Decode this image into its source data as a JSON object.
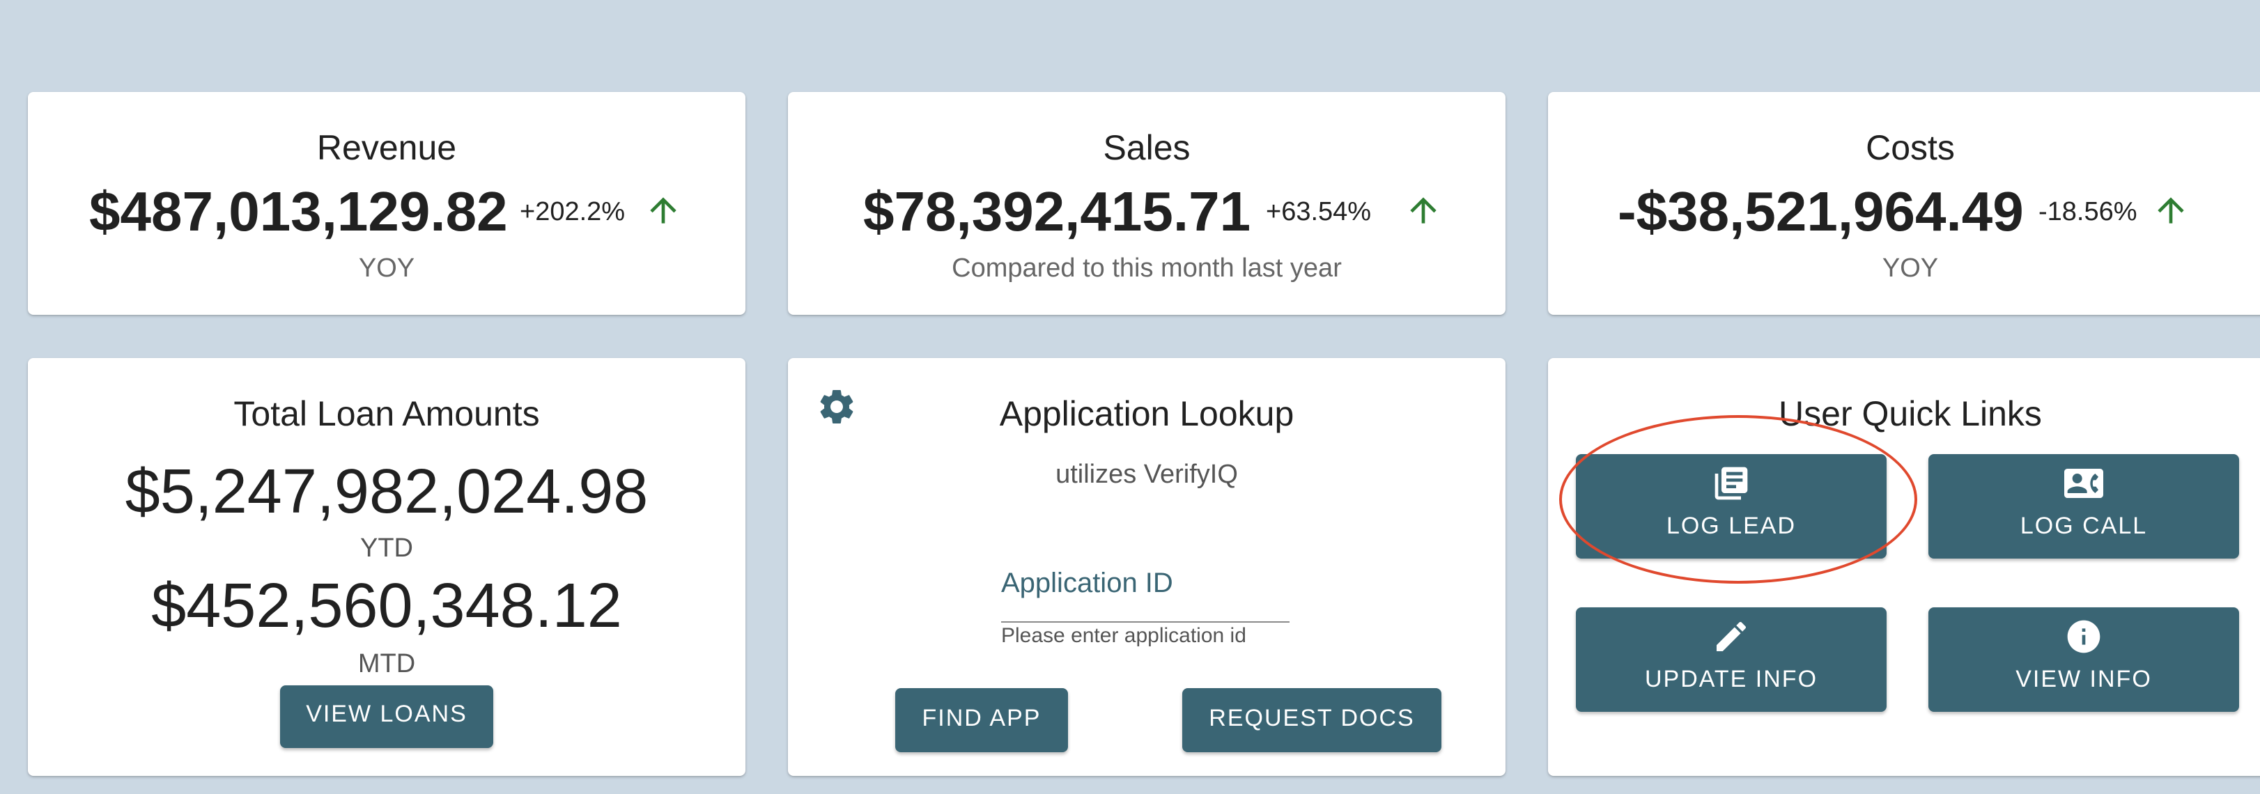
{
  "revenue": {
    "title": "Revenue",
    "value": "$487,013,129.82",
    "change": "+202.2%",
    "caption": "YOY"
  },
  "sales": {
    "title": "Sales",
    "value": "$78,392,415.71",
    "change": "+63.54%",
    "caption": "Compared to this month last year"
  },
  "costs": {
    "title": "Costs",
    "value": "-$38,521,964.49",
    "change": "-18.56%",
    "caption": "YOY"
  },
  "loans": {
    "title": "Total Loan Amounts",
    "ytd_value": "$5,247,982,024.98",
    "ytd_label": "YTD",
    "mtd_value": "$452,560,348.12",
    "mtd_label": "MTD",
    "view_button": "VIEW LOANS"
  },
  "lookup": {
    "title": "Application Lookup",
    "subtitle": "utilizes VerifyIQ",
    "field_label": "Application ID",
    "field_value": "",
    "helper": "Please enter application id",
    "find_button": "FIND APP",
    "request_button": "REQUEST DOCS",
    "settings_icon": "gear-icon"
  },
  "quick_links": {
    "title": "User Quick Links",
    "items": [
      {
        "label": "LOG LEAD",
        "icon": "newspaper-icon"
      },
      {
        "label": "LOG CALL",
        "icon": "contact-phone-icon"
      },
      {
        "label": "UPDATE INFO",
        "icon": "pencil-icon"
      },
      {
        "label": "VIEW INFO",
        "icon": "info-icon"
      }
    ]
  },
  "colors": {
    "background": "#cbd8e3",
    "card": "#ffffff",
    "button": "#3a6574",
    "trend_up": "#2e7d32",
    "annotation": "#e0492e"
  }
}
